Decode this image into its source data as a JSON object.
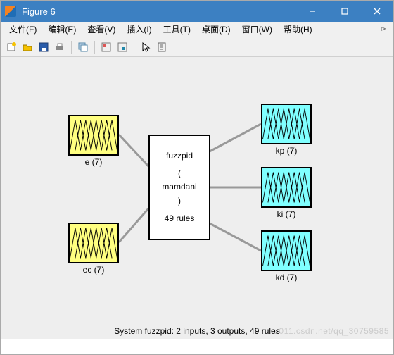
{
  "window": {
    "title": "Figure 6"
  },
  "menu": {
    "file": "文件(F)",
    "edit": "编辑(E)",
    "view": "查看(V)",
    "insert": "插入(I)",
    "tools": "工具(T)",
    "desktop": "桌面(D)",
    "window": "窗口(W)",
    "help": "帮助(H)"
  },
  "toolbar_icons": {
    "new": "new-figure-icon",
    "open": "open-icon",
    "save": "save-icon",
    "print": "print-icon",
    "copy": "copy-figure-icon",
    "link_off": "link-axes-off-icon",
    "link_on": "link-axes-on-icon",
    "pointer": "pointer-icon",
    "colorbar": "insert-colorbar-icon"
  },
  "fis": {
    "name": "fuzzpid",
    "type_open": "(",
    "type": "mamdani",
    "type_close": ")",
    "rules": "49 rules",
    "inputs": [
      {
        "label": "e (7)"
      },
      {
        "label": "ec (7)"
      }
    ],
    "outputs": [
      {
        "label": "kp (7)"
      },
      {
        "label": "ki (7)"
      },
      {
        "label": "kd (7)"
      }
    ]
  },
  "status": "System fuzzpid: 2 inputs, 3 outputs, 49 rules",
  "watermark": "u011.csdn.net/qq_30759585"
}
